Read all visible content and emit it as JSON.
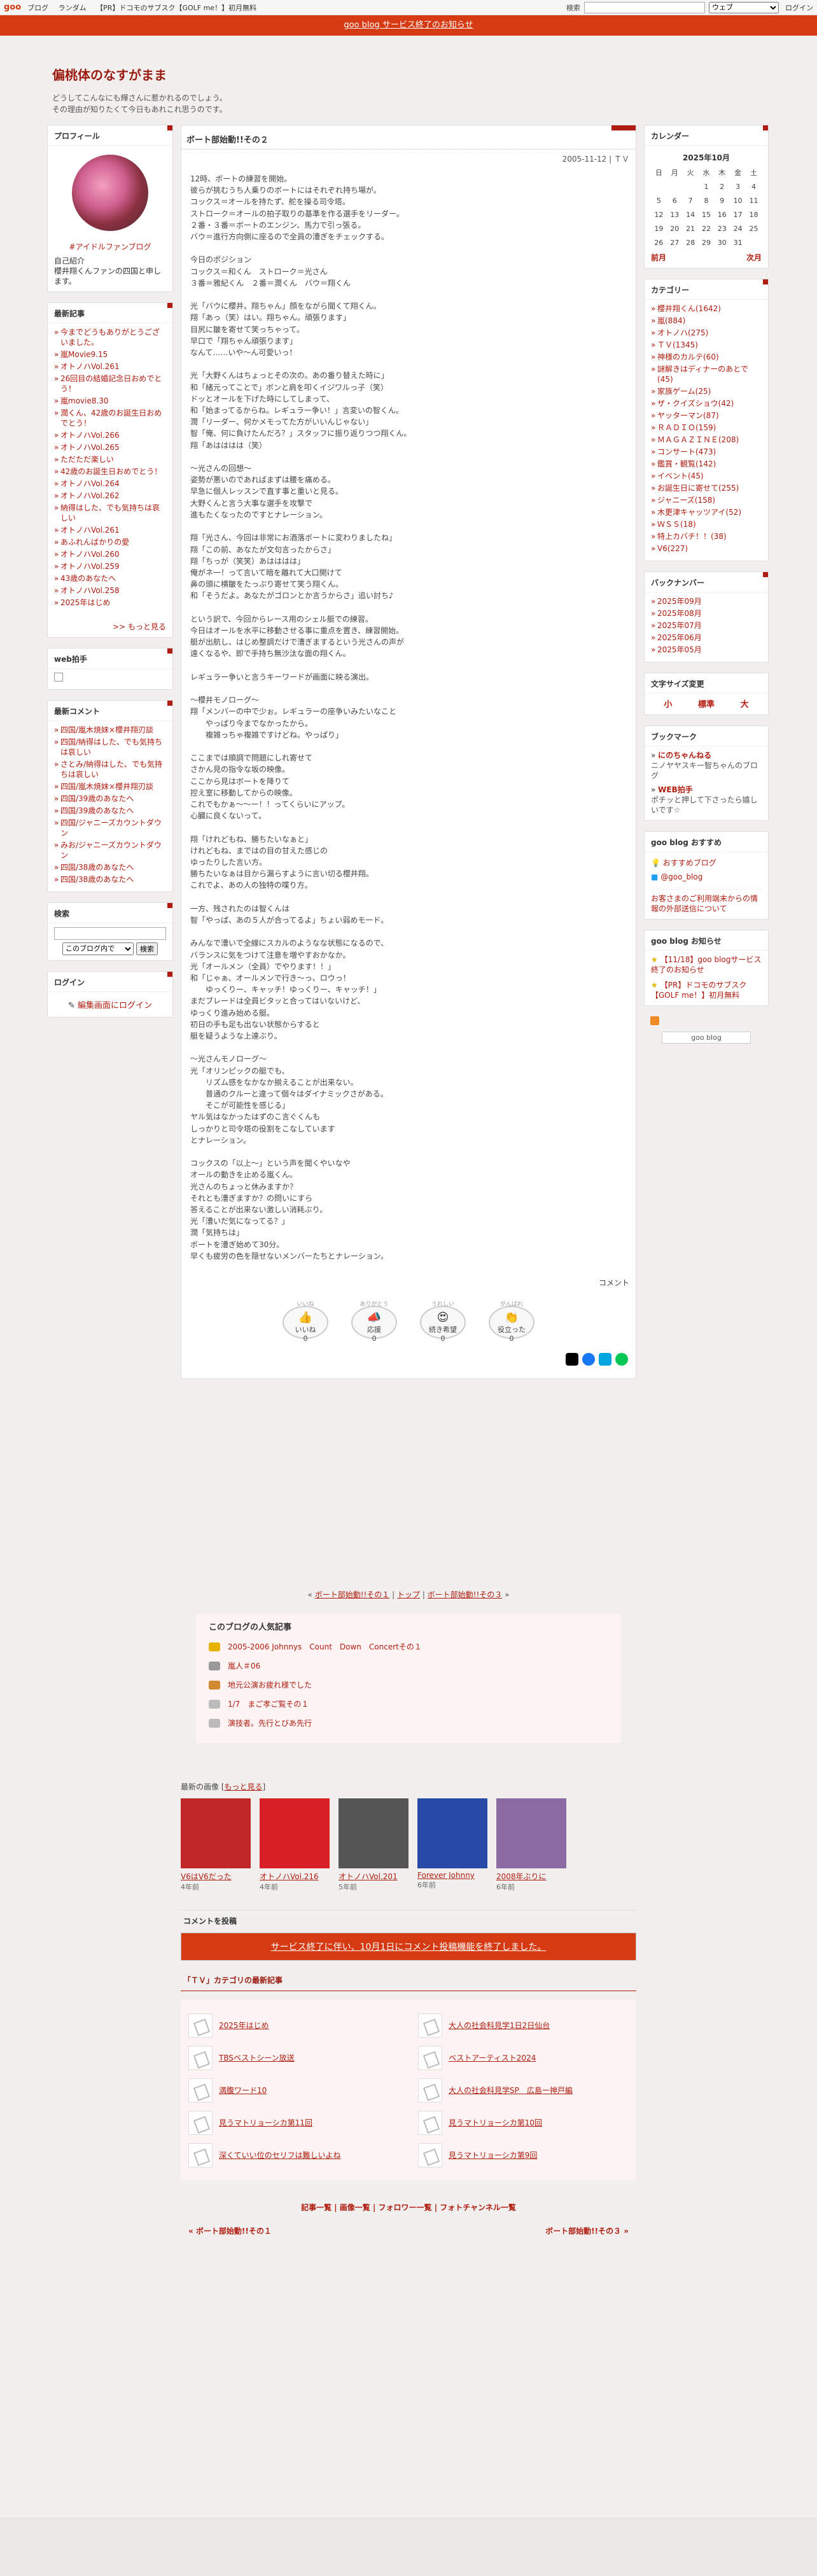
{
  "topbar": {
    "logo": "goo",
    "nav": [
      "ブログ",
      "ランダム",
      "【PR】ドコモのサブスク【GOLF me！】初月無料"
    ],
    "search_label": "検索",
    "search_scope": "ウェブ",
    "login": "ログイン"
  },
  "notice": "goo blog サービス終了のお知らせ",
  "blog": {
    "title": "偏桃体のなすがまま",
    "desc1": "どうしてこんなにも輝さんに惹かれるのでしょう。",
    "desc2": "その理由が知りたくて今日もあれこれ思うのです。"
  },
  "profile": {
    "heading": "プロフィール",
    "link": "#アイドルファンブログ",
    "label": "自己紹介",
    "text": "櫻井翔くんファンの四国と申します。"
  },
  "recent_posts": {
    "heading": "最新記事",
    "items": [
      "今までどうもありがとうございました。",
      "嵐Movie9.15",
      "オトノハVol.261",
      "26回目の結婚記念日おめでとう！",
      "嵐movie8.30",
      "潤くん、42歳のお誕生日おめでとう！",
      "オトノハVol.266",
      "オトノハVol.265",
      "ただただ楽しい",
      "42歳のお誕生日おめでとう！",
      "オトノハVol.264",
      "オトノハVol.262",
      "納得はした、でも気持ちは哀しい",
      "オトノハVol.261",
      "あふれんばかりの愛",
      "オトノハVol.260",
      "オトノハVol.259",
      "43歳のあなたへ",
      "オトノハVol.258",
      "2025年はじめ"
    ],
    "more": ">> もっと見る"
  },
  "web_clap": {
    "heading": "web拍手"
  },
  "recent_comments": {
    "heading": "最新コメント",
    "items": [
      "四国/嵐木焼妹×櫻井翔刃談",
      "四国/納得はした、でも気持ちは哀しい",
      "さとみ/納得はした、でも気持ちは哀しい",
      "四国/嵐木焼妹×櫻井翔刃談",
      "四国/39歳のあなたへ",
      "四国/39歳のあなたへ",
      "四国/ジャニーズカウントダウン",
      "みお/ジャニーズカウントダウン",
      "四国/38歳のあなたへ",
      "四国/38歳のあなたへ"
    ]
  },
  "search_box": {
    "heading": "検索",
    "scope": "このブログ内で",
    "button": "検索"
  },
  "login_box": {
    "heading": "ログイン",
    "link": "編集画面にログイン"
  },
  "article": {
    "title": "ボート部始動!!その２",
    "date": "2005-11-12 | ＴＶ",
    "body": "12時、ボートの練習を開始。\n彼らが挑むうち人乗りのボートにはそれぞれ持ち場が。\nコックス＝オールを持たず、舵を操る司令塔。\nストローク＝オールの拍子取りの基準を作る選手をリーダー。\n２番・３番＝ボートのエンジン、馬力で引っ張る。\nバウ＝進行方向側に座るので全員の漕ぎをチェックする。\n\n今日のポジション\nコックス＝和くん　ストローク＝光さん\n３番＝雅紀くん　２番＝潤くん　バウ＝翔くん\n\n光「バウに櫻井。翔ちゃん」顔をながら聞くて翔くん。\n翔「あっ（笑）はい。翔ちゃん。頑張ります」\n目尻に皺を寄せて笑っちゃって。\n早口で「翔ちゃん頑張ります」\nなんて……いや～ん可愛いっ！\n\n光「大野くんはちょっとその次の。あの番り替えた時に」\n和「緒元ってことで」ボンと肩を叩くイジワルっ子（笑）\nドッとオールを下げた時にしてしまって、\n和「始まってるからね。レギュラー争い！」言変いの智くん。\n潤「リーダー、何かメモってた方がいいんじゃない」\n智「俺、何に負けたんだろ？」スタッフに振り返りつつ翔くん。\n翔「あはははは（笑）\n\n～光さんの回想～\n姿勢が悪いのであればまずは腰を痛める。\n早急に個人レッスンで直す事と重いと見る。\n大野くんと言う大事な選手を攻撃で\n進もたくなったのですとナレーション。\n\n翔「光さん、今回は非常にお酒落ボートに変わりましたね」\n翔「この前、あなたが文句言ったからさ」\n翔「ちっが（笑笑）あはははは」\n俺がネ一！って言いて暗を離れて大口開けて\n鼻の頭に横皺をたっぷり寄せて笑う翔くん。\n和「そうだよ。あなたがゴロンとか言うからさ」追い討ち♪\n\nという訳で、今回からレース用のシェル艇での練習。\n今日はオールを水平に移動させる事に重点を置き、練習開始。\n艇が出航し、はじめ整調だけで漕ぎまするという光さんの声が\n遠くなるや、即で手持ち無沙汰な面の翔くん。\n\nレギュラー争いと言うキーワードが画面に映る演出。\n\n～櫻井モノローグ～\n翔「メンバーの中で少ぉ。レギュラーの座争いみたいなこと\n　　やっぱり今までなかったから。\n　　複雑っちゃ複雑ですけどね。やっぱり」\n\nここまでは順調で問題にしれ寄せて\nさかん見の指令な坂の映像。\nここから見はボートを降りて\n控え室に移動してからの映像。\nこれでもかぁ～～ー！！ってくらいにアップ。\n心臓に良くないって。\n\n翔「けれどもね、勝ちたいなぁと」\nけれどもね、まではの目の甘えた感じの\nゆったりした言い方。\n勝ちたいなぁは目から漏らすように言い切る櫻井翔。\nこれでよ、あの人の独特の喋り方。\n\n一方、残されたのは智くんは\n智「やっぱ、あの５人が合ってるよ」ちょい弱めモード。\n\nみんなで漕いで全線にスカルのようなな状態になるので、\nバランスに気をつけて注意を増やすおかなか。\n光「オールメン（全員）でやります！！」\n和「じゃぁ、オールメンで行き～っ、ロウっ！\n　　ゆっくりー、キャッチ！ゆっくりー、キャッチ！」\nまだブレードは全員ビタッと合ってはいないけど、\nゆっくり進み始める艇。\n初日の手も足も出ない状態からすると\n艇を疑うような上達ぶり。\n\n～光さんモノローグ～\n光「オリンピックの艇でも、\n　　リズム感をなかなか揃えることが出来ない。\n　　普通のクルーと違って個々はダイナミックさがある。\n　　そこが可能性を感じる」\nヤル気はなかったはずのこ言ぐくんも\nしっかりと司令塔の役割をこなしています\nとナレーション。\n\nコックスの「以上～」という声を聞くやいなや\nオールの動きを止める嵐くん。\n光さんのちょっと休みますか？\nそれとも漕ぎますか？の問いにすら\n答えることが出来ない激しい消耗ぶり。\n光「漕いだ気になってる？」\n潤「気持ちは」\nボートを漕ぎ始めて30分。\n早くも疲労の色を隠せないメンバーたちとナレーション。",
    "comment_link": "コメント"
  },
  "reactions": [
    {
      "label": "いいね",
      "num": "0",
      "icon": "thumbs-up-icon"
    },
    {
      "label": "応援",
      "num": "0",
      "icon": "megaphone-icon"
    },
    {
      "label": "続き希望",
      "num": "0",
      "icon": "heart-eyes-icon"
    },
    {
      "label": "役立った",
      "num": "0",
      "icon": "clap-icon"
    }
  ],
  "reaction_tags": [
    "いいね",
    "ありがとう",
    "うれしい",
    "がんばれ"
  ],
  "pager": {
    "prev": "ボート部始動!!その１",
    "top": "トップ",
    "next": "ボート部始動!!その３"
  },
  "popular": {
    "heading": "このブログの人気記事",
    "items": [
      "2005-2006 Johnnys　Count　Down　Concertその１",
      "嵐人＃06",
      "地元公演お疲れ様でした",
      "1/7　まご孝ご覧その１",
      "演技者。先行とびあ先行"
    ]
  },
  "recent_images": {
    "label": "最新の画像",
    "more": "もっと見る",
    "items": [
      {
        "cap": "V6はV6だった",
        "age": "4年前",
        "color": "#c0282a"
      },
      {
        "cap": "オトノハVol.216",
        "age": "4年前",
        "color": "#d81f25"
      },
      {
        "cap": "オトノハVol.201",
        "age": "5年前",
        "color": "#555555"
      },
      {
        "cap": "Forever Johnny",
        "age": "6年前",
        "color": "#2a4aa8"
      },
      {
        "cap": "2008年ぶりに",
        "age": "6年前",
        "color": "#8a6aa0"
      }
    ]
  },
  "comment_section": {
    "heading": "コメントを投稿",
    "alert": "サービス終了に伴い、10月1日にコメント投稿機能を終了しました。"
  },
  "related": {
    "heading": "「ＴＶ」カテゴリの最新記事",
    "items": [
      "2025年はじめ",
      "大人の社会科見学1日2日仙台",
      "TBSベストシーン放送",
      "ベストアーティスト2024",
      "満腹ワード10",
      "大人の社会科見学SP　広島ー神戸編",
      "見うマトリョーシカ第11回",
      "見うマトリョーシカ第10回",
      "深くていい位のセリフは難しいよね",
      "見うマトリョーシカ第9回"
    ]
  },
  "footer": {
    "links": "記事一覧 | 画像一覧 | フォロワー一覧 | フォトチャンネル一覧",
    "prev": "« ボート部始動!!その１",
    "next": "ボート部始動!!その３ »"
  },
  "calendar": {
    "heading": "カレンダー",
    "title": "2025年10月",
    "weekdays": [
      "日",
      "月",
      "火",
      "水",
      "木",
      "金",
      "土"
    ],
    "weeks": [
      [
        "",
        "",
        "",
        "1",
        "2",
        "3",
        "4"
      ],
      [
        "5",
        "6",
        "7",
        "8",
        "9",
        "10",
        "11"
      ],
      [
        "12",
        "13",
        "14",
        "15",
        "16",
        "17",
        "18"
      ],
      [
        "19",
        "20",
        "21",
        "22",
        "23",
        "24",
        "25"
      ],
      [
        "26",
        "27",
        "28",
        "29",
        "30",
        "31",
        ""
      ]
    ],
    "prev": "前月",
    "next": "次月"
  },
  "categories": {
    "heading": "カテゴリー",
    "items": [
      "櫻井翔くん(1642)",
      "嵐(884)",
      "オトノハ(275)",
      "ＴＶ(1345)",
      "神様のカルテ(60)",
      "謎解きはディナーのあとで(45)",
      "家族ゲーム(25)",
      "ザ・クイズショウ(42)",
      "ヤッターマン(87)",
      "ＲＡＤＩＯ(159)",
      "ＭＡＧＡＺＩＮＥ(208)",
      "コンサート(473)",
      "鑑賞・観覧(142)",
      "イベント(45)",
      "お誕生日に寄せて(255)",
      "ジャニーズ(158)",
      "木更津キャッツアイ(52)",
      "ＷＳＳ(18)",
      "特上カバチ！！(38)",
      "V6(227)"
    ]
  },
  "backnumber": {
    "heading": "バックナンバー",
    "items": [
      "2025年09月",
      "2025年08月",
      "2025年07月",
      "2025年06月",
      "2025年05月"
    ]
  },
  "fontsize": {
    "heading": "文字サイズ変更",
    "small": "小",
    "normal": "標準",
    "large": "大"
  },
  "bookmarks": {
    "heading": "ブックマーク",
    "items": [
      {
        "name": "にのちゃんねる",
        "desc": "ニノヤヤスキー智ちゃんのブログ"
      },
      {
        "name": "WEB拍手",
        "desc": "ポチッと押して下さったら嬉しいです☆"
      }
    ]
  },
  "recommend": {
    "heading": "goo blog おすすめ",
    "items": [
      "おすすめブログ",
      "@goo_blog"
    ],
    "note": "お客さまのご利用端末からの情報の外部送信について"
  },
  "announce": {
    "heading": "goo blog お知らせ",
    "items": [
      "【11/18】goo blogサービス終了のお知らせ",
      "【PR】ドコモのサブスク【GOLF me！】初月無料"
    ],
    "badge": "goo blog"
  }
}
